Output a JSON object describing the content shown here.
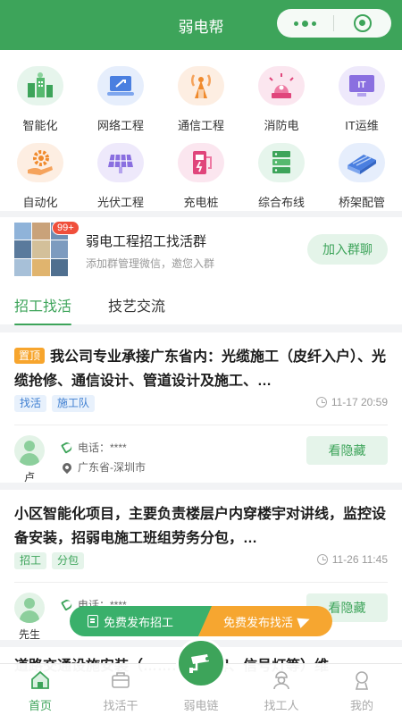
{
  "header": {
    "title": "弱电帮"
  },
  "categories": [
    {
      "label": "智能化",
      "icon": "smart-building-icon",
      "bg": "#e6f5ec",
      "color": "#3da45a"
    },
    {
      "label": "网络工程",
      "icon": "network-laptop-icon",
      "bg": "#e6eefc",
      "color": "#4a7fe0"
    },
    {
      "label": "通信工程",
      "icon": "signal-tower-icon",
      "bg": "#fdeee2",
      "color": "#f08a2c"
    },
    {
      "label": "消防电",
      "icon": "fire-alarm-icon",
      "bg": "#fbe6ef",
      "color": "#e0457b"
    },
    {
      "label": "IT运维",
      "icon": "it-monitor-icon",
      "bg": "#eee9fb",
      "color": "#8a6fe0"
    },
    {
      "label": "自动化",
      "icon": "gear-hand-icon",
      "bg": "#fdeee2",
      "color": "#f08a2c"
    },
    {
      "label": "光伏工程",
      "icon": "solar-panel-icon",
      "bg": "#eee9fb",
      "color": "#8a6fe0"
    },
    {
      "label": "充电桩",
      "icon": "charging-pile-icon",
      "bg": "#fbe6ef",
      "color": "#e0457b"
    },
    {
      "label": "综合布线",
      "icon": "server-rack-icon",
      "bg": "#e6f5ec",
      "color": "#3da45a"
    },
    {
      "label": "桥架配管",
      "icon": "cable-tray-icon",
      "bg": "#e6eefc",
      "color": "#4a7fe0"
    }
  ],
  "group": {
    "badge": "99+",
    "name": "弱电工程招工找活群",
    "subtitle": "添加群管理微信，邀您入群",
    "join_label": "加入群聊"
  },
  "tabs": [
    {
      "label": "招工找活",
      "active": true
    },
    {
      "label": "技艺交流",
      "active": false
    }
  ],
  "posts": [
    {
      "pinned_label": "置顶",
      "title": "我公司专业承接广东省内：光缆施工（皮纤入户）、光缆抢修、通信设计、管道设计及施工、…",
      "tags": [
        {
          "label": "找活",
          "style": "blue"
        },
        {
          "label": "施工队",
          "style": "blue"
        }
      ],
      "time": "11-17 20:59",
      "user": "卢",
      "phone": "电话：****",
      "location": "广东省-深圳市",
      "reveal_label": "看隐藏"
    },
    {
      "pinned_label": "",
      "title": "小区智能化项目，主要负责楼层户内穿楼宇对讲线，监控设备安装，招弱电施工班组劳务分包，…",
      "tags": [
        {
          "label": "招工",
          "style": "green"
        },
        {
          "label": "分包",
          "style": "green"
        }
      ],
      "time": "11-26 11:45",
      "user": "先生",
      "phone": "电话：****",
      "location": "",
      "reveal_label": "看隐藏"
    },
    {
      "title": "道路交通设施安装（…………标牌、信号灯等）维"
    }
  ],
  "publish": {
    "recruit_label": "免费发布招工",
    "find_work_label": "免费发布找活"
  },
  "nav": [
    {
      "label": "首页",
      "icon": "home-icon",
      "active": true
    },
    {
      "label": "找活干",
      "icon": "briefcase-icon",
      "active": false
    },
    {
      "label": "弱电链",
      "icon": "camera-icon",
      "active": false
    },
    {
      "label": "找工人",
      "icon": "worker-icon",
      "active": false
    },
    {
      "label": "我的",
      "icon": "profile-icon",
      "active": false
    }
  ],
  "colors": {
    "brand": "#3da45a",
    "accent_orange": "#f6a630",
    "pin": "#f7a52d",
    "badge": "#f04f3b"
  }
}
